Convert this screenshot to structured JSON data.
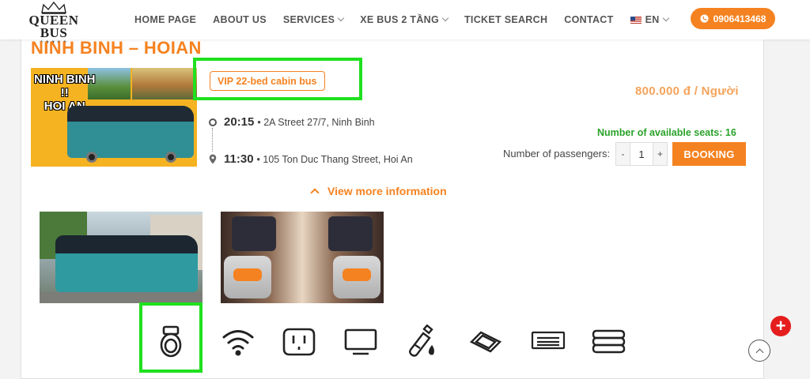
{
  "header": {
    "logo_text": "QUEEN BUS",
    "logo_stars": "★★★★★",
    "nav": [
      {
        "label": "HOME PAGE",
        "dropdown": false
      },
      {
        "label": "ABOUT US",
        "dropdown": false
      },
      {
        "label": "SERVICES",
        "dropdown": true
      },
      {
        "label": "XE BUS 2 TẦNG",
        "dropdown": true
      },
      {
        "label": "TICKET SEARCH",
        "dropdown": false
      },
      {
        "label": "CONTACT",
        "dropdown": false
      }
    ],
    "language": "EN",
    "phone": "0906413468"
  },
  "trip": {
    "title": "NINH BINH – HOIAN",
    "thumb_text_1": "NINH BINH",
    "thumb_text_2": "!!",
    "thumb_text_3": "HOI AN",
    "bus_type": "VIP 22-bed cabin bus",
    "price": "800.000 đ / Người",
    "departure_time": "20:15",
    "departure_address": "• 2A Street 27/7, Ninh Binh",
    "arrival_time": "11:30",
    "arrival_address": "• 105 Ton Duc Thang Street, Hoi An",
    "seats_available": "Number of available seats: 16",
    "passengers_label": "Number of passengers:",
    "passenger_minus": "-",
    "passenger_count": "1",
    "passenger_plus": "+",
    "booking_label": "BOOKING",
    "more_info": "View more information"
  },
  "amenities": [
    "toilet-icon",
    "wifi-icon",
    "power-outlet-icon",
    "tv-icon",
    "water-bottle-icon",
    "wet-towel-icon",
    "air-conditioner-icon",
    "blanket-icon"
  ],
  "colors": {
    "accent": "#f58220",
    "seats_green": "#2aa22a",
    "highlight": "#1fe01f",
    "plus_red": "#e51d1d"
  }
}
